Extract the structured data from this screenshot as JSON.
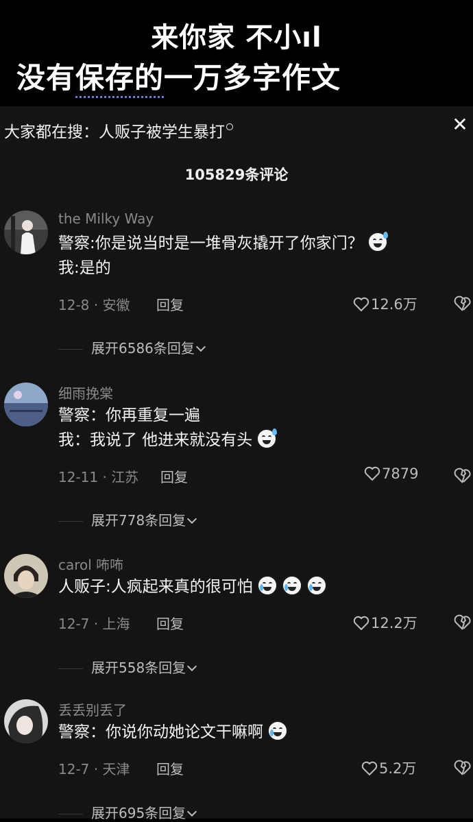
{
  "banner": {
    "line1": "来你家 不小ıl",
    "line2_underlined": "保存的",
    "line2_prefix": "没有",
    "line2_suffix": "一万多字作文"
  },
  "search_hint": {
    "prefix": "大家都在搜：",
    "query": "人贩子被学生暴打",
    "close_icon": "close-icon"
  },
  "comment_count": "105829条评论",
  "comments": [
    {
      "username": "the Milky Way",
      "lines": [
        "警察:你是说当时是一堆骨灰撬开了你家门？",
        "我:是的"
      ],
      "date_location": "12-8 · 安徽",
      "reply_label": "回复",
      "likes": "12.6万",
      "expand_label": "展开6586条回复"
    },
    {
      "username": "细雨挽棠",
      "lines": [
        "警察：你再重复一遍",
        "我：我说了 他进来就没有头"
      ],
      "date_location": "12-11 · 江苏",
      "reply_label": "回复",
      "likes": "7879",
      "expand_label": "展开778条回复"
    },
    {
      "username": "carol 咘咘",
      "lines": [
        "人贩子:人疯起来真的很可怕"
      ],
      "date_location": "12-7 · 上海",
      "reply_label": "回复",
      "likes": "12.2万",
      "expand_label": "展开558条回复"
    },
    {
      "username": "丢丢别丢了",
      "lines": [
        "警察：你说你动她论文干嘛啊"
      ],
      "date_location": "12-7 · 天津",
      "reply_label": "回复",
      "likes": "5.2万",
      "expand_label": "展开695条回复"
    }
  ],
  "colors": {
    "sheet_bg": "#141414",
    "muted_text": "#8a8a8a",
    "accent_underline": "#6f7bd4"
  }
}
